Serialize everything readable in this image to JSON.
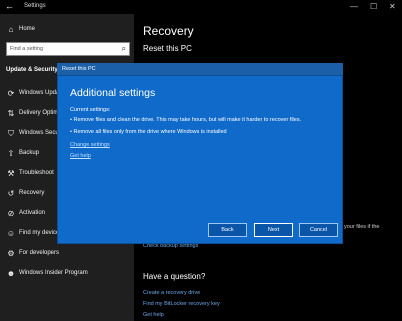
{
  "window": {
    "title": "Settings",
    "controls": {
      "minimize": "—",
      "maximize": "☐",
      "close": "✕"
    }
  },
  "sidebar": {
    "home": {
      "label": "Home",
      "icon": "home-icon"
    },
    "search": {
      "placeholder": "Find a setting"
    },
    "section": "Update & Security",
    "items": [
      {
        "label": "Windows Update",
        "icon": "sync-icon"
      },
      {
        "label": "Delivery Optimization",
        "icon": "delivery-icon"
      },
      {
        "label": "Windows Security",
        "icon": "shield-icon"
      },
      {
        "label": "Backup",
        "icon": "backup-icon"
      },
      {
        "label": "Troubleshoot",
        "icon": "wrench-icon"
      },
      {
        "label": "Recovery",
        "icon": "recovery-icon"
      },
      {
        "label": "Activation",
        "icon": "check-circle-icon"
      },
      {
        "label": "Find my device",
        "icon": "person-location-icon"
      },
      {
        "label": "For developers",
        "icon": "developer-icon"
      },
      {
        "label": "Windows Insider Program",
        "icon": "insider-icon"
      }
    ]
  },
  "main": {
    "title": "Recovery",
    "subtitle": "Reset this PC",
    "partial_text": "your files if the",
    "backup_link": "Check backup settings",
    "question": "Have a question?",
    "links": [
      "Create a recovery drive",
      "Find my BitLocker recovery key",
      "Get help"
    ]
  },
  "dialog": {
    "bar_title": "Reset this PC",
    "title": "Additional settings",
    "current_label": "Current settings:",
    "bullets": [
      "Remove files and clean the drive. This may take hours, but will make it harder to recover files.",
      "Remove all files only from the drive where Windows is installed"
    ],
    "change_link": "Change settings",
    "help_link": "Get help",
    "buttons": {
      "back": "Back",
      "next": "Next",
      "cancel": "Cancel"
    }
  },
  "colors": {
    "dialog_blue": "#0f6ac9",
    "link_blue": "#6ea8e8",
    "sidebar_bg": "#1f1f1f"
  }
}
